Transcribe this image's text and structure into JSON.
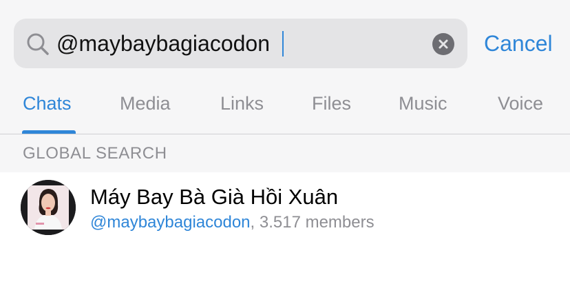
{
  "search": {
    "value": "@maybaybagiacodon",
    "cancel_label": "Cancel"
  },
  "tabs": [
    {
      "label": "Chats",
      "active": true
    },
    {
      "label": "Media",
      "active": false
    },
    {
      "label": "Links",
      "active": false
    },
    {
      "label": "Files",
      "active": false
    },
    {
      "label": "Music",
      "active": false
    },
    {
      "label": "Voice",
      "active": false
    }
  ],
  "section": {
    "title": "GLOBAL SEARCH"
  },
  "results": [
    {
      "title": "Máy Bay Bà Già Hồi Xuân",
      "username": "@maybaybagiacodon",
      "separator": ", ",
      "members": "3.517 members",
      "avatar_icon": "profile-photo"
    }
  ],
  "colors": {
    "accent": "#2f86d8",
    "background": "#f6f6f7",
    "search_field": "#e4e4e6",
    "secondary_text": "#8e8e93"
  }
}
